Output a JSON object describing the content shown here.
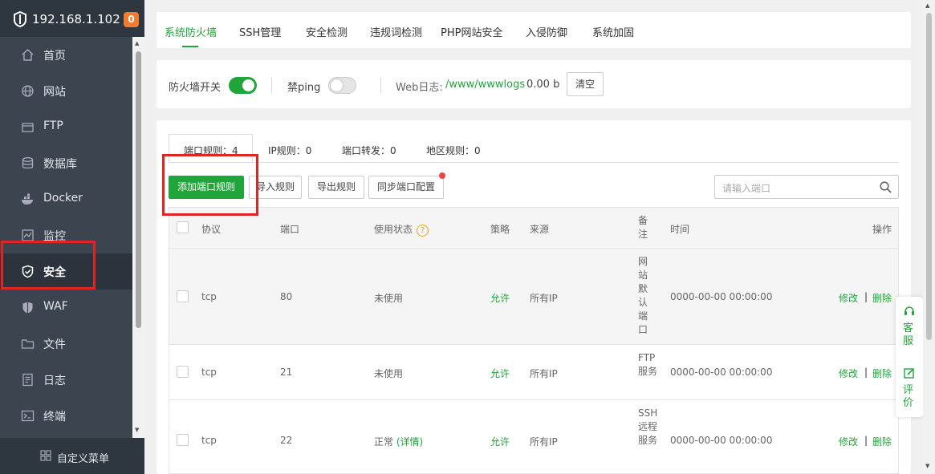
{
  "sidebar": {
    "ip": "192.168.1.102",
    "badge": "0",
    "menu": [
      {
        "label": "首页",
        "icon": "home-icon"
      },
      {
        "label": "网站",
        "icon": "globe-icon"
      },
      {
        "label": "FTP",
        "icon": "ftp-icon"
      },
      {
        "label": "数据库",
        "icon": "database-icon"
      },
      {
        "label": "Docker",
        "icon": "docker-icon"
      },
      {
        "label": "监控",
        "icon": "monitor-icon"
      },
      {
        "label": "安全",
        "icon": "shield-icon",
        "active": true
      },
      {
        "label": "WAF",
        "icon": "waf-shield-icon"
      },
      {
        "label": "文件",
        "icon": "folder-icon"
      },
      {
        "label": "日志",
        "icon": "log-icon"
      },
      {
        "label": "终端",
        "icon": "terminal-icon"
      }
    ],
    "footer": "自定义菜单"
  },
  "tabs": [
    "系统防火墙",
    "SSH管理",
    "安全检测",
    "违规词检测",
    "PHP网站安全",
    "入侵防御",
    "系统加固"
  ],
  "controls": {
    "firewall_label": "防火墙开关",
    "firewall_on": true,
    "ping_label": "禁ping",
    "ping_on": false,
    "weblog_label": "Web日志:",
    "weblog_path": "/www/wwwlogs",
    "weblog_size": "0.00 b",
    "clear_button": "清空"
  },
  "subtabs": {
    "port_rules": "端口规则：4",
    "ip_rules": "IP规则：0",
    "port_forward": "端口转发：0",
    "region_rules": "地区规则：0"
  },
  "toolbar": {
    "add": "添加端口规则",
    "import": "导入规则",
    "export": "导出规则",
    "sync": "同步端口配置",
    "search_placeholder": "请输入端口"
  },
  "table": {
    "headers": {
      "protocol": "协议",
      "port": "端口",
      "status": "使用状态",
      "policy": "策略",
      "source": "来源",
      "remark": "备注",
      "time": "时间",
      "action": "操作"
    },
    "rows": [
      {
        "protocol": "tcp",
        "port": "80",
        "status": "未使用",
        "status_link": "",
        "policy": "允许",
        "source": "所有IP",
        "remark": "网站默认端口",
        "time": "0000-00-00 00:00:00",
        "edit": "修改",
        "delete": "删除"
      },
      {
        "protocol": "tcp",
        "port": "21",
        "status": "未使用",
        "status_link": "",
        "policy": "允许",
        "source": "所有IP",
        "remark": "FTP服务",
        "time": "0000-00-00 00:00:00",
        "edit": "修改",
        "delete": "删除"
      },
      {
        "protocol": "tcp",
        "port": "22",
        "status": "正常",
        "status_link": "(详情)",
        "policy": "允许",
        "source": "所有IP",
        "remark": "SSH远程服务",
        "time": "0000-00-00 00:00:00",
        "edit": "修改",
        "delete": "删除"
      }
    ]
  },
  "float": {
    "service": "客服",
    "review": "评价"
  },
  "colors": {
    "accent": "#20a53a",
    "sidebar_bg": "#2e363f",
    "menu_bg": "#3c4450",
    "highlight": "#e02424",
    "badge": "#ef7c2f"
  }
}
